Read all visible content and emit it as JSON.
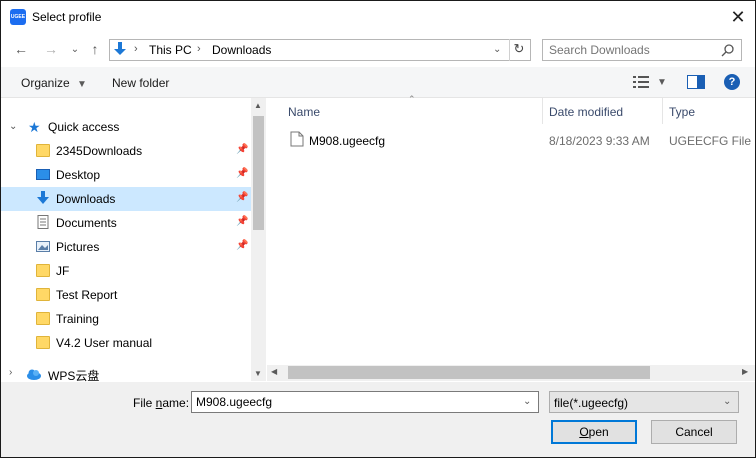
{
  "window": {
    "title": "Select profile",
    "app_icon_text": "UGEE"
  },
  "nav": {
    "breadcrumb": [
      "This PC",
      "Downloads"
    ],
    "search_placeholder": "Search Downloads"
  },
  "toolbar": {
    "organize_label": "Organize",
    "new_folder_label": "New folder"
  },
  "sidebar": {
    "quick_access_label": "Quick access",
    "items": [
      {
        "label": "2345Downloads",
        "icon": "folder-icon",
        "pinned": true
      },
      {
        "label": "Desktop",
        "icon": "desktop-icon",
        "pinned": true
      },
      {
        "label": "Downloads",
        "icon": "downloads-icon",
        "pinned": true,
        "selected": true
      },
      {
        "label": "Documents",
        "icon": "documents-icon",
        "pinned": true
      },
      {
        "label": "Pictures",
        "icon": "pictures-icon",
        "pinned": true
      },
      {
        "label": "JF",
        "icon": "folder-icon"
      },
      {
        "label": "Test Report",
        "icon": "folder-icon"
      },
      {
        "label": "Training",
        "icon": "folder-icon"
      },
      {
        "label": "V4.2 User manual",
        "icon": "folder-icon"
      }
    ],
    "wps_label": "WPS云盘"
  },
  "columns": {
    "name": "Name",
    "date": "Date modified",
    "type": "Type"
  },
  "files": [
    {
      "name": "M908.ugeecfg",
      "date": "8/18/2023 9:33 AM",
      "type": "UGEECFG File"
    }
  ],
  "bottom": {
    "file_name_label_pre": "File ",
    "file_name_label_accel": "n",
    "file_name_label_post": "ame:",
    "file_name_value": "M908.ugeecfg",
    "filter_value": "file(*.ugeecfg)",
    "open_accel": "O",
    "open_rest": "pen",
    "cancel_label": "Cancel"
  },
  "colors": {
    "accent": "#0078d7",
    "selection": "#cce8ff",
    "folder": "#ffd866"
  }
}
